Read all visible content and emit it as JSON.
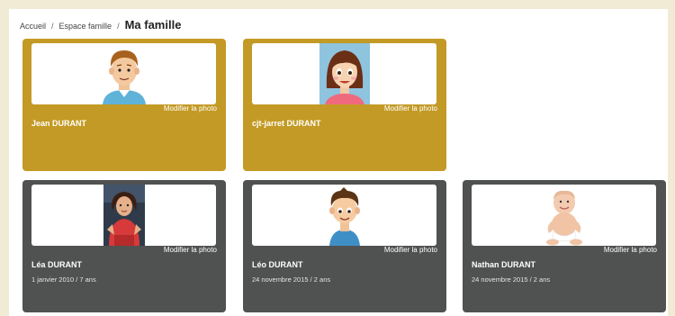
{
  "breadcrumb": {
    "items": [
      "Accueil",
      "Espace famille"
    ],
    "separator": "/",
    "current": "Ma famille"
  },
  "members": [
    {
      "name": "Jean DURANT",
      "info": "",
      "modify_label": "Modifier la photo",
      "role": "parent",
      "avatar": "man-cartoon-icon"
    },
    {
      "name": "cjt-jarret DURANT",
      "info": "",
      "modify_label": "Modifier la photo",
      "role": "parent",
      "avatar": "woman-cartoon-icon"
    },
    {
      "name": "Léa DURANT",
      "info": "1 janvier 2010 / 7 ans",
      "modify_label": "Modifier la photo",
      "role": "child",
      "avatar": "girl-photo"
    },
    {
      "name": "Léo DURANT",
      "info": "24 novembre 2015 / 2 ans",
      "modify_label": "Modifier la photo",
      "role": "child",
      "avatar": "boy-cartoon-icon"
    },
    {
      "name": "Nathan DURANT",
      "info": "24 novembre 2015 / 2 ans",
      "modify_label": "Modifier la photo",
      "role": "child",
      "avatar": "baby-photo"
    }
  ],
  "colors": {
    "parent_card": "#c39a25",
    "child_card": "#505151",
    "background": "#f1ebd6"
  }
}
